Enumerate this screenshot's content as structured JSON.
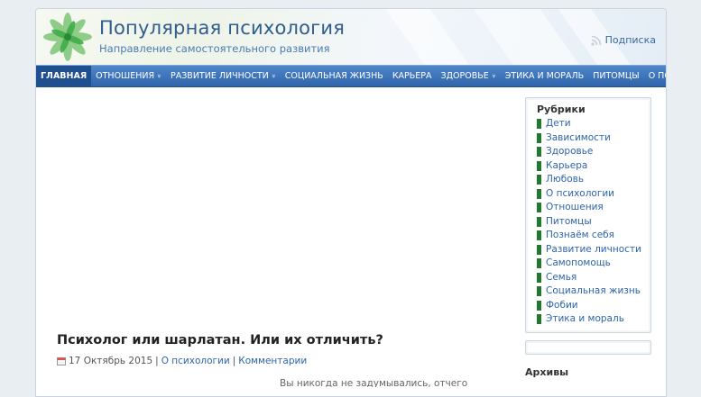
{
  "header": {
    "title": "Популярная психология",
    "subtitle": "Направление самостоятельного развития",
    "subscribe_label": "Подписка",
    "colors": {
      "title": "#2f5d8e",
      "logo_green": "#3fae49"
    }
  },
  "nav": {
    "items": [
      {
        "label": "Главная",
        "dropdown": false,
        "active": true
      },
      {
        "label": "Отношения",
        "dropdown": true
      },
      {
        "label": "Развитие личности",
        "dropdown": true
      },
      {
        "label": "Социальная жизнь",
        "dropdown": false
      },
      {
        "label": "Карьера",
        "dropdown": false
      },
      {
        "label": "Здоровье",
        "dropdown": true
      },
      {
        "label": "Этика и мораль",
        "dropdown": false
      },
      {
        "label": "Питомцы",
        "dropdown": false
      },
      {
        "label": "О психологии",
        "dropdown": false
      }
    ],
    "chevron": "»",
    "colors": {
      "bar": "#2f64ab",
      "active": "#1f4f8f"
    }
  },
  "post": {
    "title": "Психолог или шарлатан. Или их отличить?",
    "date": "17 Октябрь 2015",
    "separator": "|",
    "category": "О психологии",
    "comments": "Комментарии",
    "excerpt_partial": "Вы никогда не задумывались, отчего"
  },
  "sidebar": {
    "categories_title": "Рубрики",
    "categories": [
      "Дети",
      "Зависимости",
      "Здоровье",
      "Карьера",
      "Любовь",
      "О психологии",
      "Отношения",
      "Питомцы",
      "Познаём себя",
      "Развитие личности",
      "Самопомощь",
      "Семья",
      "Социальная жизнь",
      "Фобии",
      "Этика и мораль"
    ],
    "archives_title": "Архивы",
    "colors": {
      "bullet": "#1f7a2e",
      "link": "#2f64ab"
    }
  }
}
